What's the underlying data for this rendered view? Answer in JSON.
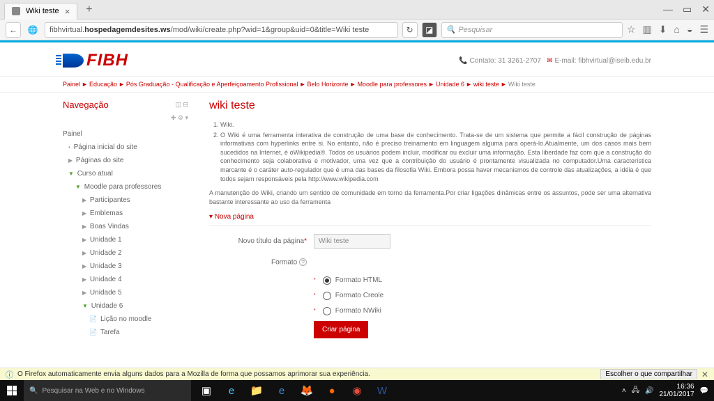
{
  "window": {
    "tab_title": "Wiki teste",
    "url_prefix": "fibhvirtual.",
    "url_bold": "hospedagemdesites.ws",
    "url_suffix": "/mod/wiki/create.php?wid=1&group&uid=0&title=Wiki teste",
    "search_placeholder": "Pesquisar"
  },
  "header": {
    "logo_text": "FIBH",
    "contact_label": "Contato:",
    "phone": "31 3261-2707",
    "email_label": "E-mail:",
    "email": "fibhvirtual@iseib.edu.br"
  },
  "breadcrumb": [
    "Painel",
    "Educação",
    "Pós Graduação - Qualificação e Aperfeiçoamento Profissional",
    "Belo Horizonte",
    "Moodle para professores",
    "Unidade 6",
    "wiki teste",
    "Wiki teste"
  ],
  "sidebar": {
    "title": "Navegação",
    "items": [
      {
        "label": "Painel",
        "lvl": 0
      },
      {
        "label": "Página inicial do site",
        "lvl": 1,
        "caret": "closed"
      },
      {
        "label": "Páginas do site",
        "lvl": 1,
        "caret": "right"
      },
      {
        "label": "Curso atual",
        "lvl": 1,
        "caret": "open"
      },
      {
        "label": "Moodle para professores",
        "lvl": 2,
        "caret": "open"
      },
      {
        "label": "Participantes",
        "lvl": 3,
        "caret": "right"
      },
      {
        "label": "Emblemas",
        "lvl": 3,
        "caret": "right"
      },
      {
        "label": "Boas Vindas",
        "lvl": 3,
        "caret": "right"
      },
      {
        "label": "Unidade 1",
        "lvl": 3,
        "caret": "right"
      },
      {
        "label": "Unidade 2",
        "lvl": 3,
        "caret": "right"
      },
      {
        "label": "Unidade 3",
        "lvl": 3,
        "caret": "right"
      },
      {
        "label": "Unidade 4",
        "lvl": 3,
        "caret": "right"
      },
      {
        "label": "Unidade 5",
        "lvl": 3,
        "caret": "right"
      },
      {
        "label": "Unidade 6",
        "lvl": 3,
        "caret": "open"
      },
      {
        "label": "Lição no moodle",
        "lvl": 4,
        "icon": "file"
      },
      {
        "label": "Tarefa",
        "lvl": 4,
        "icon": "file"
      }
    ]
  },
  "main": {
    "title": "wiki teste",
    "list_item1": "Wiki.",
    "list_item2": "O Wiki é uma ferramenta interativa de construção de uma base de conhecimento. Trata-se de um sistema que permite a fácil construção de páginas informativas com hyperlinks entre si. No entanto, não é preciso treinamento em linguagem alguma para operá-lo.Atualmente, um dos casos mais bem sucedidos na Internet, é oWikipedia®. Todos os usuários podem incluir, modificar ou excluir uma informação. Esta liberdade faz com que a construção do conhecimento seja colaborativa e motivador, uma vez que a contribuição do usuário é prontamente visualizada no computador.Uma característica marcante é o caráter auto-regulador que é uma das bases da filosofia Wiki. Embora possa haver mecanismos de controle das atualizações, a idéia é que todos sejam responsáveis pela http://www.wikipedia.com",
    "desc": "A manutenção do Wiki, criando um sentido de comunidade em torno da ferramenta.Por criar ligações dinâmicas entre os assuntos, pode ser uma alternativa bastante interessante ao uso da ferramenta",
    "subsection": "Nova página",
    "form": {
      "title_label": "Novo título da página",
      "title_value": "Wiki teste",
      "format_label": "Formato",
      "options": [
        "Formato HTML",
        "Formato Creole",
        "Formato NWiki"
      ],
      "selected": 0,
      "submit": "Criar página"
    }
  },
  "notif": {
    "text": "O Firefox automaticamente envia alguns dados para a Mozilla de forma que possamos aprimorar sua experiência.",
    "button": "Escolher o que compartilhar"
  },
  "taskbar": {
    "search": "Pesquisar na Web e no Windows",
    "time": "16:36",
    "date": "21/01/2017"
  }
}
